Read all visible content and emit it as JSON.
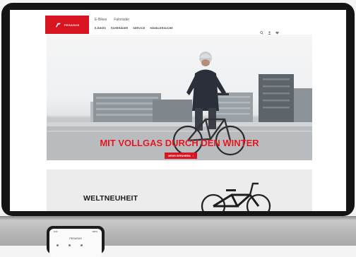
{
  "site": {
    "logo_text": "PEGASUS",
    "top_links": [
      "E-Bikes",
      "Fahrräder"
    ],
    "nav_items": [
      "E-BIKES",
      "FAHRRÄDER",
      "SERVICE",
      "HÄNDLERSUCHE"
    ],
    "nav_icons": [
      "search-icon",
      "user-icon",
      "heart-icon"
    ],
    "brand_color": "#d7141f"
  },
  "hero": {
    "headline": "MIT VOLLGAS DURCH DEN WINTER",
    "button_label": "MEHR ERFAHREN",
    "button_arrow": "›"
  },
  "section": {
    "title": "WELTNEUHEIT"
  },
  "phone": {
    "time": "9:41",
    "battery": "100%",
    "title": "PEGASUS"
  }
}
